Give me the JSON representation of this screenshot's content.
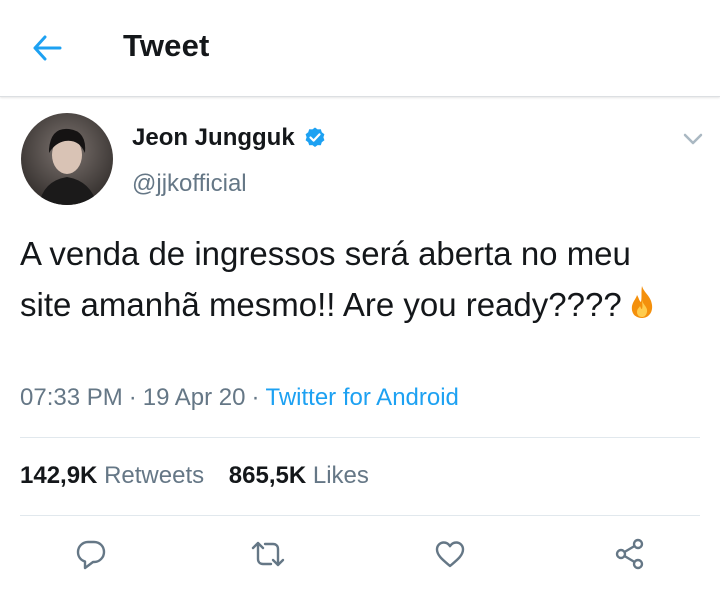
{
  "header": {
    "title": "Tweet",
    "back_icon": "arrow-left-icon"
  },
  "author": {
    "name": "Jeon Jungguk",
    "handle": "@jjkofficial",
    "verified": true
  },
  "tweet": {
    "text": "A venda de ingressos será aberta no meu site amanhã mesmo!! Are you ready????",
    "emoji": "fire-icon"
  },
  "meta": {
    "time": "07:33 PM",
    "date": "19 Apr 20",
    "separator": "·",
    "source": "Twitter for Android"
  },
  "stats": {
    "retweets_count": "142,9K",
    "retweets_label": "Retweets",
    "likes_count": "865,5K",
    "likes_label": "Likes"
  },
  "actions": [
    "reply-icon",
    "retweet-icon",
    "like-icon",
    "share-icon"
  ],
  "colors": {
    "accent": "#1da1f2",
    "secondary_text": "#657786",
    "primary_text": "#14171a",
    "divider": "#e1e8ed"
  }
}
